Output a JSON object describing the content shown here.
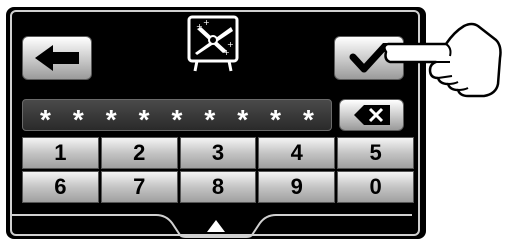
{
  "icons": {
    "back": "arrow-left-icon",
    "confirm": "checkmark-icon",
    "delete": "backspace-icon",
    "app": "knife-sharpening-icon",
    "expand": "triangle-up-icon",
    "pointer": "pointing-hand-icon"
  },
  "password": {
    "masked_chars": [
      "*",
      "*",
      "*",
      "*",
      "*",
      "*",
      "*",
      "*",
      "*"
    ]
  },
  "keypad": {
    "keys": [
      "1",
      "2",
      "3",
      "4",
      "5",
      "6",
      "7",
      "8",
      "9",
      "0"
    ]
  }
}
